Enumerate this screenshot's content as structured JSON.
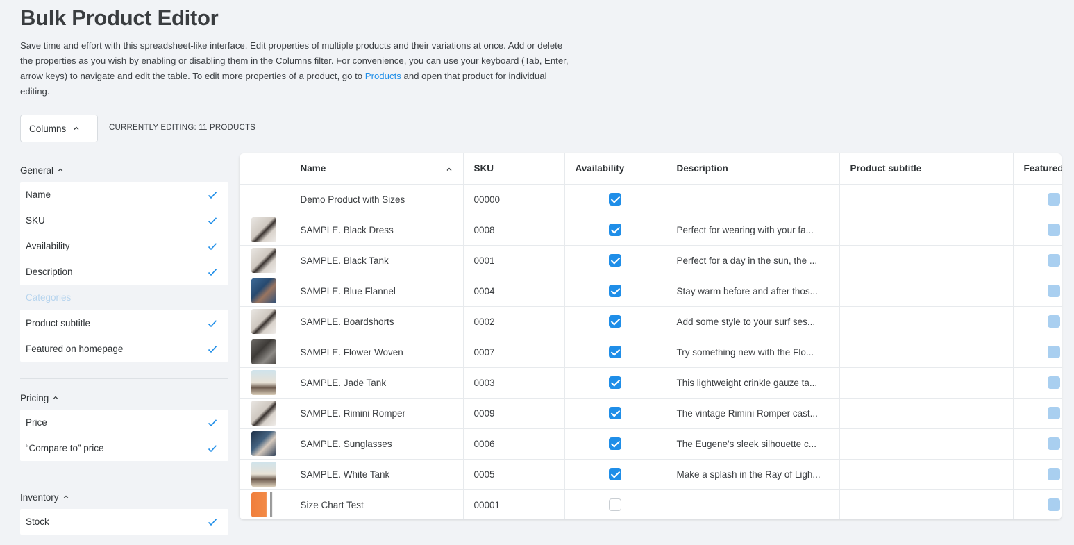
{
  "page": {
    "title": "Bulk Product Editor",
    "intro_text": "Save time and effort with this spreadsheet-like interface. Edit properties of multiple products and their variations at once. Add or delete the properties as you wish by enabling or disabling them in the Columns filter. For convenience, you can use your keyboard (Tab, Enter, arrow keys) to navigate and edit the table. To edit more properties of a product, go to",
    "intro_link": "Products",
    "intro_tail": "and open that product for individual editing.",
    "columns_button": "Columns",
    "editing_label": "CURRENTLY EDITING: 11 PRODUCTS"
  },
  "sidebar": {
    "groups": [
      {
        "label": "General",
        "items": [
          {
            "label": "Name",
            "enabled": true
          },
          {
            "label": "SKU",
            "enabled": true
          },
          {
            "label": "Availability",
            "enabled": true
          },
          {
            "label": "Description",
            "enabled": true
          },
          {
            "label": "Categories",
            "enabled": false
          },
          {
            "label": "Product subtitle",
            "enabled": true
          },
          {
            "label": "Featured on homepage",
            "enabled": true
          }
        ]
      },
      {
        "label": "Pricing",
        "items": [
          {
            "label": "Price",
            "enabled": true
          },
          {
            "label": "“Compare to” price",
            "enabled": true
          }
        ]
      },
      {
        "label": "Inventory",
        "items": [
          {
            "label": "Stock",
            "enabled": true
          }
        ]
      }
    ]
  },
  "table": {
    "headers": [
      "",
      "Name",
      "SKU",
      "Availability",
      "Description",
      "Product subtitle",
      "Featured"
    ],
    "rows": [
      {
        "name": "Demo Product with Sizes",
        "sku": "00000",
        "available": true,
        "description": "",
        "subtitle": "",
        "thumb": "none"
      },
      {
        "name": "SAMPLE. Black Dress",
        "sku": "0008",
        "available": true,
        "description": "Perfect for wearing with your fa...",
        "subtitle": "",
        "thumb": "light"
      },
      {
        "name": "SAMPLE. Black Tank",
        "sku": "0001",
        "available": true,
        "description": "Perfect for a day in the sun, the ...",
        "subtitle": "",
        "thumb": "light"
      },
      {
        "name": "SAMPLE. Blue Flannel",
        "sku": "0004",
        "available": true,
        "description": "Stay warm before and after thos...",
        "subtitle": "",
        "thumb": "blue"
      },
      {
        "name": "SAMPLE. Boardshorts",
        "sku": "0002",
        "available": true,
        "description": "Add some style to your surf ses...",
        "subtitle": "",
        "thumb": "light"
      },
      {
        "name": "SAMPLE. Flower Woven",
        "sku": "0007",
        "available": true,
        "description": "Try something new with the Flo...",
        "subtitle": "",
        "thumb": "dark"
      },
      {
        "name": "SAMPLE. Jade Tank",
        "sku": "0003",
        "available": true,
        "description": "This lightweight crinkle gauze ta...",
        "subtitle": "",
        "thumb": "beach"
      },
      {
        "name": "SAMPLE. Rimini Romper",
        "sku": "0009",
        "available": true,
        "description": "The vintage Rimini Romper cast...",
        "subtitle": "",
        "thumb": "light"
      },
      {
        "name": "SAMPLE. Sunglasses",
        "sku": "0006",
        "available": true,
        "description": "The Eugene's sleek silhouette c...",
        "subtitle": "",
        "thumb": "navy"
      },
      {
        "name": "SAMPLE. White Tank",
        "sku": "0005",
        "available": true,
        "description": "Make a splash in the Ray of Ligh...",
        "subtitle": "",
        "thumb": "beach"
      },
      {
        "name": "Size Chart Test",
        "sku": "00001",
        "available": false,
        "description": "",
        "subtitle": "",
        "thumb": "chart"
      }
    ]
  },
  "colors": {
    "accent": "#1f8ee8",
    "background": "#f1f3f6",
    "disabled_text": "#b6d4ee"
  }
}
